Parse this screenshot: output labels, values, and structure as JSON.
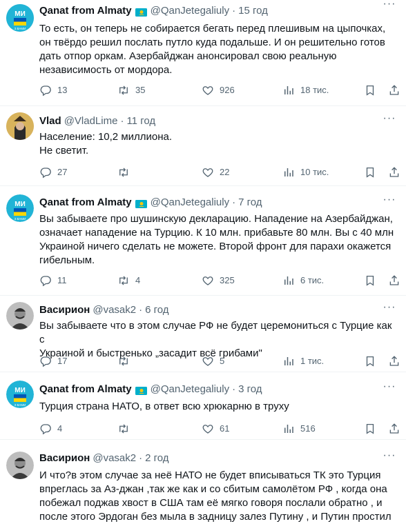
{
  "tweets": [
    {
      "name": "Qanat from Almaty",
      "handle": "@QanJetegaliuly",
      "dot": "·",
      "time": "15 год",
      "avatar_text": "МИ",
      "avatar_sub": "З ВАМИ",
      "lines": [
        "То есть, он теперь не собирается бегать перед плешивым на цыпочках,",
        "он твёрдо решил послать путло куда подальше. И он решительно готов",
        "дать отпор оркам. Азербайджан анонсировал свою реальную",
        "независимость от мордора."
      ],
      "replies": "13",
      "retweets": "35",
      "likes": "926",
      "views": "18 тис."
    },
    {
      "name": "Vlad",
      "handle": "@VladLime",
      "dot": "·",
      "time": "11 год",
      "lines": [
        "Население: 10,2 миллиона.",
        "Не светит."
      ],
      "replies": "27",
      "retweets": "",
      "likes": "22",
      "views": "10 тис."
    },
    {
      "name": "Qanat from Almaty",
      "handle": "@QanJetegaliuly",
      "dot": "·",
      "time": "7 год",
      "avatar_text": "МИ",
      "avatar_sub": "З ВАМИ",
      "lines": [
        "Вы забываете про шушинскую декларацию. Нападение на Азербайджан,",
        "означает нападение на Турцию. К 10 млн. прибавьте 80 млн. Вы с 40 млн",
        "Украиной ничего сделать не можете.  Второй фронт для парахи окажется",
        "гибельным."
      ],
      "replies": "11",
      "retweets": "4",
      "likes": "325",
      "views": "6 тис."
    },
    {
      "name": "Васирион",
      "handle": "@vasak2",
      "dot": "·",
      "time": "6 год",
      "lines": [
        "Вы забываете что в этом случае РФ не будет церемониться с Турцие как с",
        "Украиной и быстренько „засадит всё грибами\""
      ],
      "replies": "17",
      "retweets": "",
      "likes": "5",
      "views": "1 тис."
    },
    {
      "name": "Qanat from Almaty",
      "handle": "@QanJetegaliuly",
      "dot": "·",
      "time": "3 год",
      "avatar_text": "МИ",
      "avatar_sub": "З ВАМИ",
      "lines": [
        "Турция страна НАТО, в ответ всю хрюкарню в труху"
      ],
      "replies": "4",
      "retweets": "",
      "likes": "61",
      "views": "516"
    },
    {
      "name": "Васирион",
      "handle": "@vasak2",
      "dot": "·",
      "time": "2 год",
      "lines": [
        "И что?в этом случае за неё НАТО не будет вписываться ТК это Турция",
        "впреглась за Аз-джан ,так же как и со сбитым самолётом РФ , когда она",
        "побежал поджав хвост в США там её мягко говоря послали обратно , и",
        "после этого Эрдоган без мыла в задницу залез Путину , и Путин простил"
      ]
    }
  ],
  "colors": {
    "text": "#0f1419",
    "muted": "#536471",
    "divider": "#eff3f4",
    "thread": "#cfd9de",
    "kz_flag": "#00afca",
    "kz_sun": "#fec50c"
  },
  "icons": [
    "reply-icon",
    "retweet-icon",
    "like-icon",
    "views-icon",
    "bookmark-icon",
    "share-icon",
    "more-icon",
    "kazakhstan-flag-icon"
  ]
}
